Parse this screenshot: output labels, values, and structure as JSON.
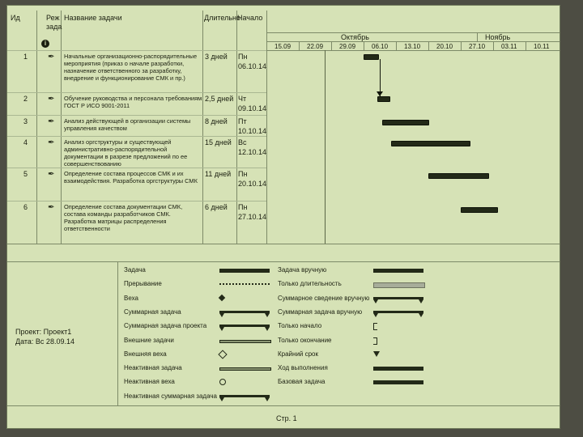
{
  "header": {
    "col_id": "Ид",
    "col_mode_top": "Реж",
    "col_mode_bottom": "зада",
    "col_name": "Название задачи",
    "col_duration": "Длительно",
    "col_start": "Начало",
    "info_icon": "info-icon"
  },
  "timescale": {
    "months": [
      "Октябрь",
      "Ноябрь"
    ],
    "weeks": [
      "15.09",
      "22.09",
      "29.09",
      "06.10",
      "13.10",
      "20.10",
      "27.10",
      "03.11",
      "10.11"
    ]
  },
  "tasks": [
    {
      "id": "1",
      "name": "Начальные организационно-распорядительные мероприятия (приказ о начале разработки, назначение ответственного за разработку, внедрение и функционирование СМК и пр.)",
      "duration": "3 дней",
      "start_day": "Пн",
      "start_date": "06.10.14",
      "bar_start": "06.10.14",
      "bar_days": 3
    },
    {
      "id": "2",
      "name": "Обучение руководства и персонала требованиям ГОСТ Р ИСО 9001-2011",
      "duration": "2,5 дней",
      "start_day": "Чт",
      "start_date": "09.10.14",
      "bar_start": "09.10.14",
      "bar_days": 2.5
    },
    {
      "id": "3",
      "name": "Анализ действующей в организации системы управления качеством",
      "duration": "8 дней",
      "start_day": "Пт",
      "start_date": "10.10.14",
      "bar_start": "10.10.14",
      "bar_days": 8
    },
    {
      "id": "4",
      "name": "Анализ оргструктуры и существующей административно-распорядительной документации в разрезе предложений по ее совершенствованию",
      "duration": "15 дней",
      "start_day": "Вс",
      "start_date": "12.10.14",
      "bar_start": "12.10.14",
      "bar_days": 15
    },
    {
      "id": "5",
      "name": "Определение состава процессов СМК и их взаимодействия. Разработка оргструктуры СМК",
      "duration": "11 дней",
      "start_day": "Пн",
      "start_date": "20.10.14",
      "bar_start": "20.10.14",
      "bar_days": 11
    },
    {
      "id": "6",
      "name": "Определение состава документации СМК, состава команды разработчиков СМК. Разработка матрицы распределения ответственности",
      "duration": "6 дней",
      "start_day": "Пн",
      "start_date": "27.10.14",
      "bar_start": "27.10.14",
      "bar_days": 6
    }
  ],
  "task_mode_icon": "pushpin-icon",
  "project": {
    "project_line": "Проект: Проект1",
    "date_line": "Дата: Вс 28.09.14"
  },
  "legend": {
    "left": [
      "Задача",
      "Прерывание",
      "Веха",
      "Суммарная задача",
      "Суммарная задача проекта",
      "Внешние задачи",
      "Внешняя веха",
      "Неактивная задача",
      "Неактивная веха",
      "Неактивная суммарная задача"
    ],
    "right": [
      "Задача вручную",
      "Только длительность",
      "Суммарное сведение вручную",
      "Суммарная задача вручную",
      "Только начало",
      "Только окончание",
      "Крайний срок",
      "Ход выполнения",
      "Базовая задача"
    ]
  },
  "footer": {
    "page": "Стр. 1"
  }
}
